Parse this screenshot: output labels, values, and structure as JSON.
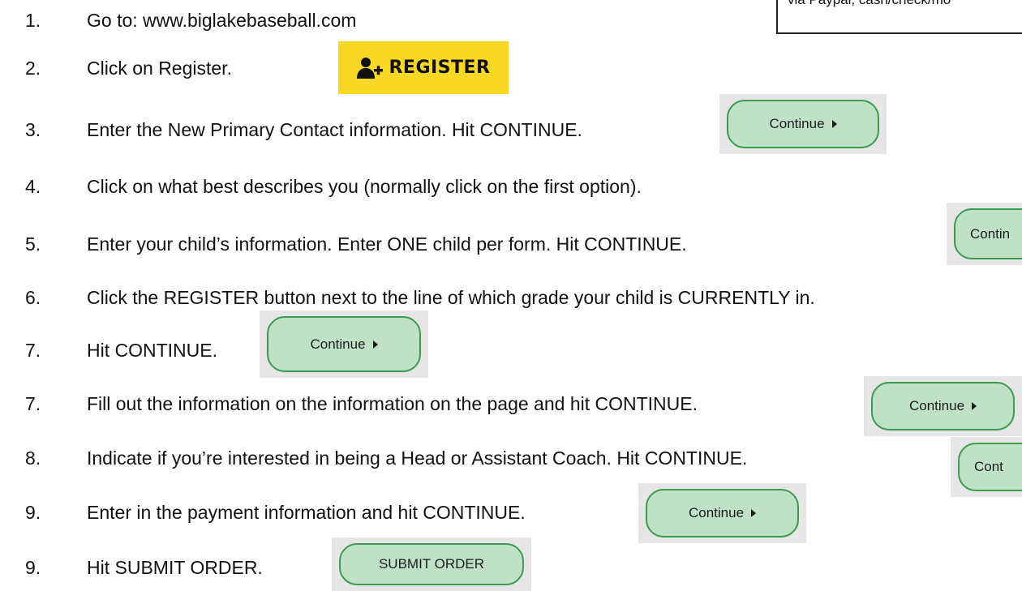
{
  "note": {
    "text": "via Paypal, cash/check/mo"
  },
  "steps": [
    {
      "num": "1.",
      "text": "Go to: www.biglakebaseball.com"
    },
    {
      "num": "2.",
      "text": "Click on Register."
    },
    {
      "num": "3.",
      "text": "Enter the New Primary Contact information. Hit CONTINUE."
    },
    {
      "num": "4.",
      "text": "Click on what best describes you (normally click on the first option)."
    },
    {
      "num": "5.",
      "text": "Enter your child’s information. Enter ONE child per form.  Hit CONTINUE."
    },
    {
      "num": "6.",
      "text": "Click the REGISTER button next to the line of which grade your child is CURRENTLY in."
    },
    {
      "num": "7.",
      "text": "Hit CONTINUE."
    },
    {
      "num": "7.",
      "text": "Fill out the information on the information on the page and hit CONTINUE."
    },
    {
      "num": "8.",
      "text": "Indicate if you’re interested in being a Head or Assistant Coach.  Hit CONTINUE."
    },
    {
      "num": "9.",
      "text": "Enter in the payment information and hit CONTINUE."
    },
    {
      "num": "9.",
      "text": "Hit SUBMIT ORDER."
    }
  ],
  "buttons": {
    "register_label": "REGISTER",
    "continue_label": "Continue",
    "continue_partial_5": "Contin",
    "continue_partial_8": "Cont",
    "submit_label": "SUBMIT ORDER"
  },
  "colors": {
    "register_bg": "#f8d824",
    "button_fill": "#bfe2c6",
    "button_border": "#3b9a4f"
  }
}
